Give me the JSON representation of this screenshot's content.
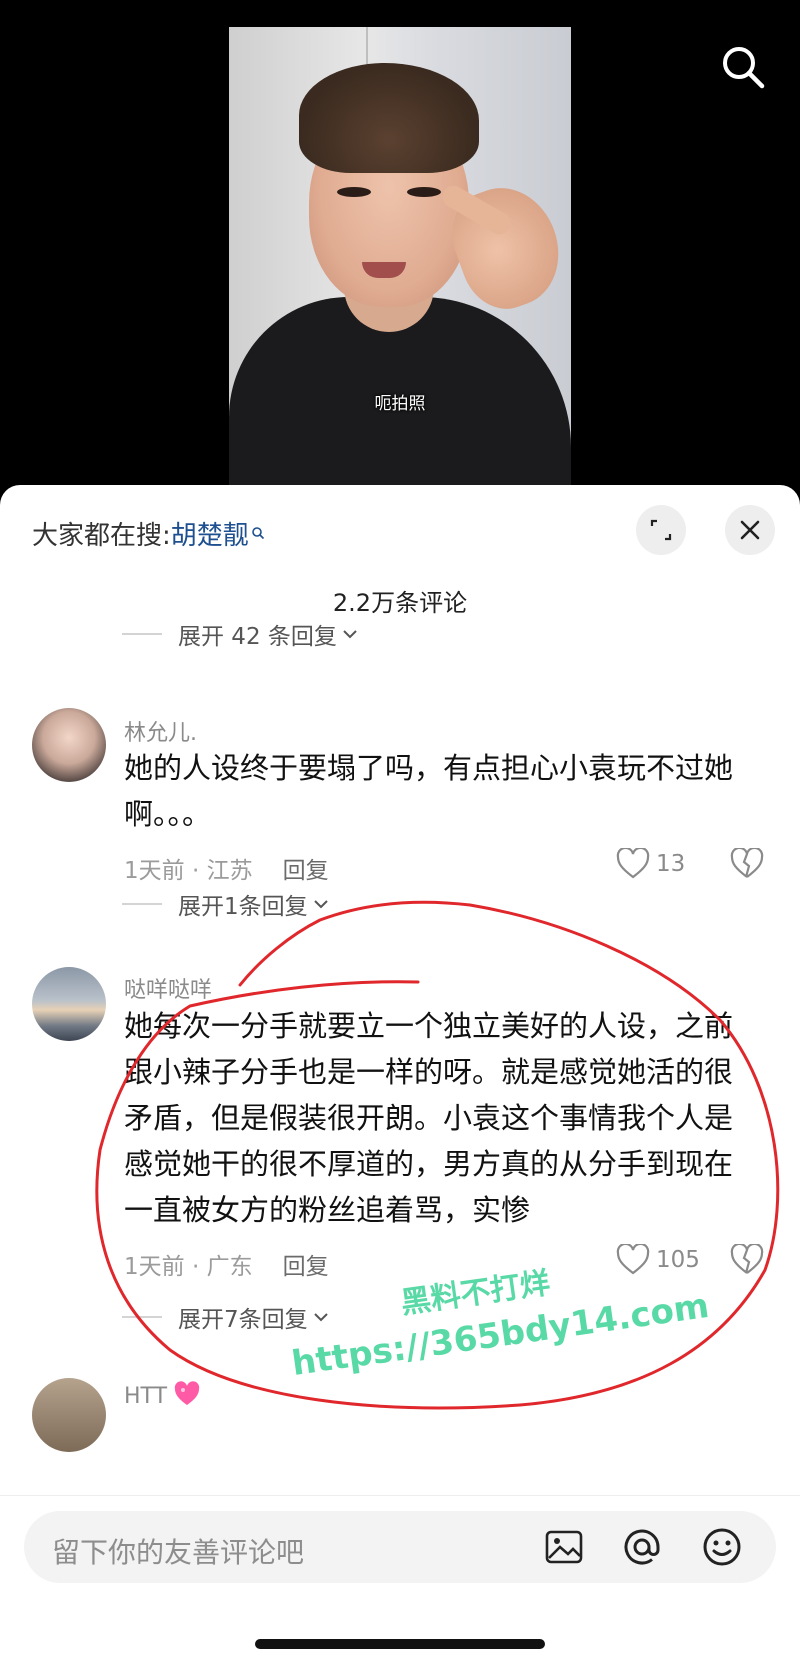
{
  "video": {
    "subtitle": "呃拍照"
  },
  "sheet": {
    "search_prefix": "大家都在搜:",
    "search_term": "胡楚靓",
    "comment_count_title": "2.2万条评论",
    "top_expand": "展开 42 条回复",
    "comments": [
      {
        "username": "林允儿.",
        "text": "她的人设终于要塌了吗，有点担心小袁玩不过她啊。。。",
        "time_location": "1天前 · 江苏",
        "reply_label": "回复",
        "likes": "13",
        "expand": "展开1条回复"
      },
      {
        "username": "哒咩哒咩",
        "text": "她每次一分手就要立一个独立美好的人设，之前跟小辣子分手也是一样的呀。就是感觉她活的很矛盾，但是假装很开朗。小袁这个事情我个人是感觉她干的很不厚道的，男方真的从分手到现在一直被女方的粉丝追着骂，实惨",
        "time_location": "1天前 · 广东",
        "reply_label": "回复",
        "likes": "105",
        "expand": "展开7条回复"
      },
      {
        "username": "HTT"
      }
    ]
  },
  "input": {
    "placeholder": "留下你的友善评论吧"
  },
  "watermark": {
    "line1": "黑料不打烊",
    "line2": "https://365bdy14.com"
  },
  "colors": {
    "search_term": "#1e4f8f",
    "annotation_circle": "#e0282c",
    "watermark": "#3cd296"
  },
  "icons": [
    "search-icon",
    "expand-icon",
    "close-icon",
    "heart-icon",
    "broken-heart-icon",
    "image-icon",
    "at-icon",
    "emoji-icon",
    "chevron-down-icon"
  ]
}
